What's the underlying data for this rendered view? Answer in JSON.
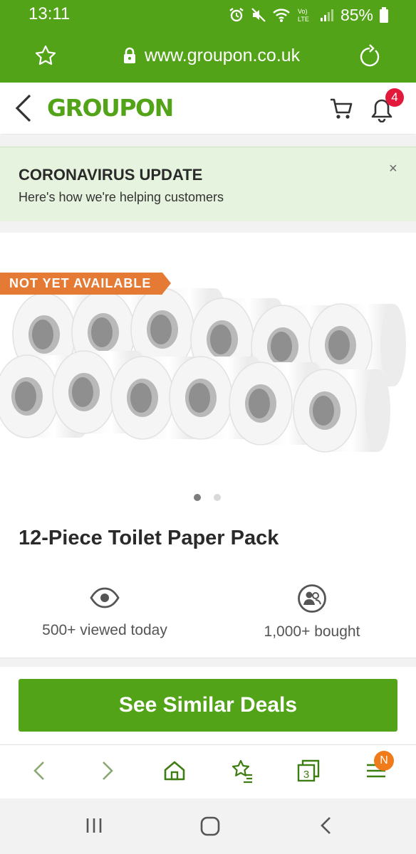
{
  "status_bar": {
    "time": "13:11",
    "battery": "85%",
    "network": "Vo)) LTE"
  },
  "browser": {
    "url": "www.groupon.co.uk",
    "tab_count": "3",
    "menu_badge": "N"
  },
  "header": {
    "logo": "GROUPON",
    "notification_count": "4"
  },
  "banner": {
    "title": "CORONAVIRUS UPDATE",
    "subtitle": "Here's how we're helping customers",
    "close": "×"
  },
  "product": {
    "badge": "NOT YET AVAILABLE",
    "title": "12-Piece Toilet Paper Pack",
    "stats": [
      {
        "icon": "eye-icon",
        "label": "500+ viewed today"
      },
      {
        "icon": "people-icon",
        "label": "1,000+ bought"
      }
    ],
    "image_dots": {
      "count": 2,
      "active": 1
    }
  },
  "cta": {
    "label": "See Similar Deals"
  },
  "colors": {
    "brand_green": "#53a318",
    "badge_orange": "#e57a34",
    "notification_red": "#e3193b",
    "banner_bg": "#e6f3de"
  }
}
